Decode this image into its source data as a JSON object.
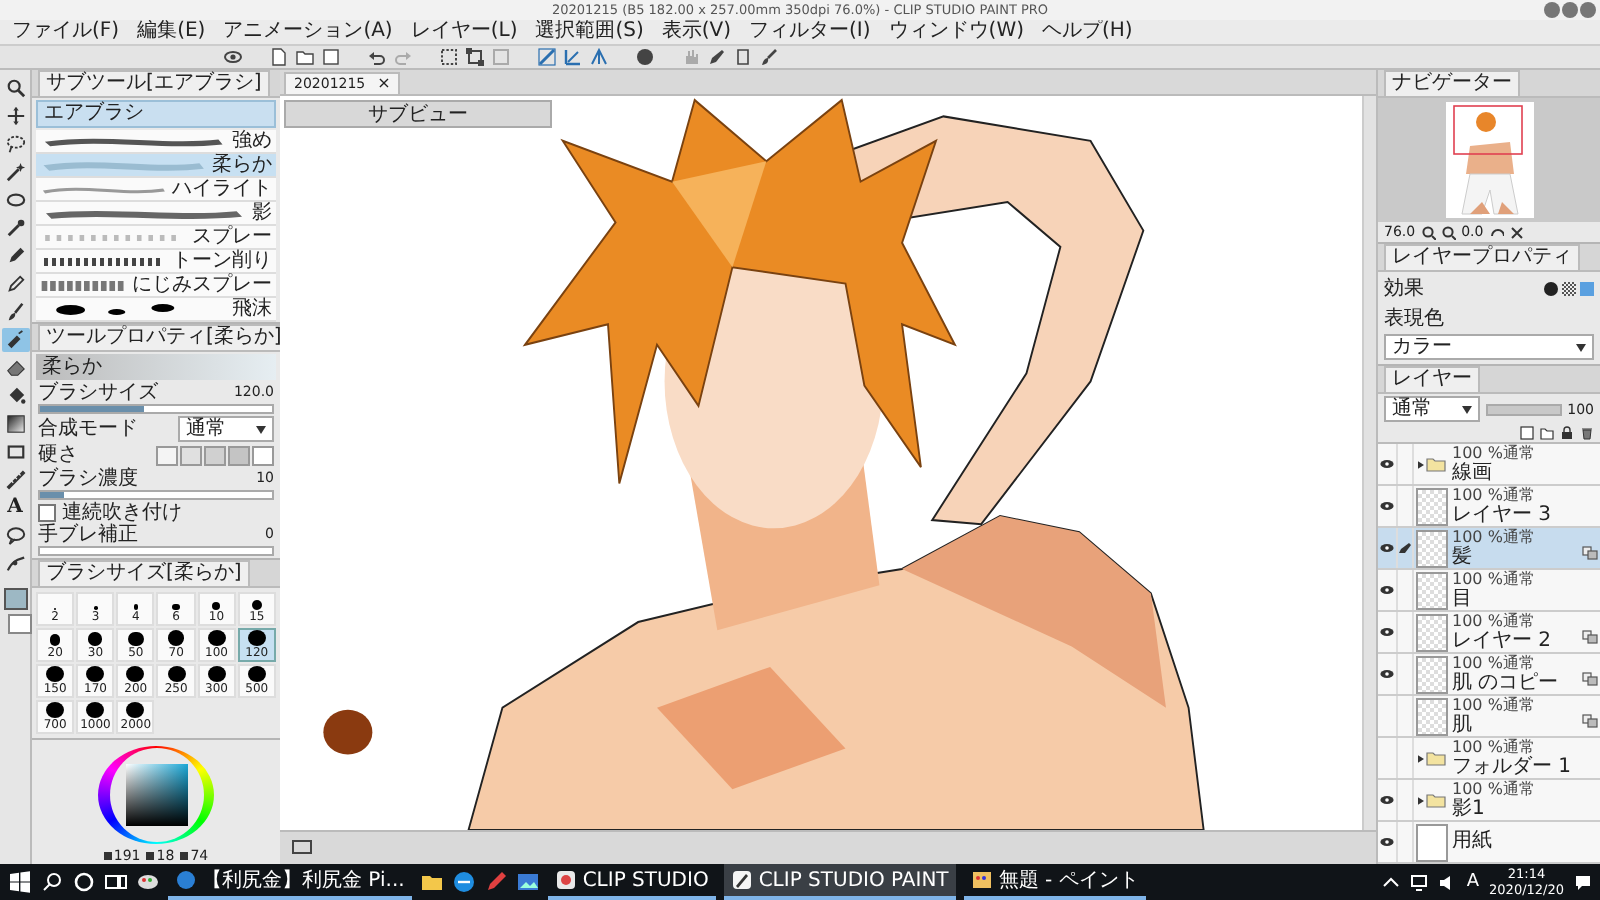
{
  "window": {
    "title": "20201215 (B5 182.00 x 257.00mm 350dpi 76.0%) - CLIP STUDIO PAINT PRO"
  },
  "menu": [
    "ファイル(F)",
    "編集(E)",
    "アニメーション(A)",
    "レイヤー(L)",
    "選択範囲(S)",
    "表示(V)",
    "フィルター(I)",
    "ウィンドウ(W)",
    "ヘルプ(H)"
  ],
  "tools": [
    {
      "kind": "zoom",
      "selected": false
    },
    {
      "kind": "move",
      "selected": false
    },
    {
      "kind": "lasso",
      "selected": false
    },
    {
      "kind": "wand",
      "selected": false
    },
    {
      "kind": "ellipse",
      "selected": false
    },
    {
      "kind": "dropper",
      "selected": false
    },
    {
      "kind": "pen",
      "selected": false
    },
    {
      "kind": "pencil",
      "selected": false
    },
    {
      "kind": "brush",
      "selected": false
    },
    {
      "kind": "airbrush",
      "selected": true
    },
    {
      "kind": "eraser",
      "selected": false
    },
    {
      "kind": "fill",
      "selected": false
    },
    {
      "kind": "gradient",
      "selected": false
    },
    {
      "kind": "figure",
      "selected": false
    },
    {
      "kind": "ruler",
      "selected": false
    },
    {
      "kind": "text",
      "glyph": "A",
      "selected": false
    },
    {
      "kind": "balloon",
      "selected": false
    },
    {
      "kind": "correct",
      "selected": false
    }
  ],
  "subtool_panel": {
    "tab": "サブツール[エアブラシ]",
    "group": "エアブラシ",
    "items": [
      {
        "label": "強め",
        "selected": false
      },
      {
        "label": "柔らか",
        "selected": true
      },
      {
        "label": "ハイライト",
        "selected": false
      },
      {
        "label": "影",
        "selected": false
      },
      {
        "label": "スプレー",
        "selected": false
      },
      {
        "label": "トーン削り",
        "selected": false
      },
      {
        "label": "にじみスプレー",
        "selected": false
      },
      {
        "label": "飛沫",
        "selected": false
      }
    ]
  },
  "tool_property": {
    "tab": "ツールプロパティ[柔らか]",
    "preset": "柔らか",
    "rows": [
      {
        "kind": "slider",
        "label": "ブラシサイズ",
        "value": "120.0",
        "level": 0.45
      },
      {
        "kind": "select",
        "label": "合成モード",
        "value": "通常"
      },
      {
        "kind": "swatches",
        "label": "硬さ"
      },
      {
        "kind": "slider",
        "label": "ブラシ濃度",
        "value": "10",
        "level": 0.1
      },
      {
        "kind": "checkbox",
        "label": "連続吹き付け",
        "checked": false
      },
      {
        "kind": "slider",
        "label": "手ブレ補正",
        "value": "0",
        "level": 0
      }
    ]
  },
  "brush_size_panel": {
    "tab": "ブラシサイズ[柔らか]",
    "sizes": [
      {
        "label": "2",
        "selected": false
      },
      {
        "label": "3",
        "selected": false
      },
      {
        "label": "4",
        "selected": false
      },
      {
        "label": "6",
        "selected": false
      },
      {
        "label": "10",
        "selected": false
      },
      {
        "label": "15",
        "selected": false
      },
      {
        "label": "20",
        "selected": false
      },
      {
        "label": "30",
        "selected": false
      },
      {
        "label": "50",
        "selected": false
      },
      {
        "label": "70",
        "selected": false
      },
      {
        "label": "100",
        "selected": false
      },
      {
        "label": "120",
        "selected": true
      },
      {
        "label": "150",
        "selected": false
      },
      {
        "label": "170",
        "selected": false
      },
      {
        "label": "200",
        "selected": false
      },
      {
        "label": "250",
        "selected": false
      },
      {
        "label": "300",
        "selected": false
      },
      {
        "label": "500",
        "selected": false
      },
      {
        "label": "700",
        "selected": false
      },
      {
        "label": "1000",
        "selected": false
      },
      {
        "label": "2000",
        "selected": false
      }
    ]
  },
  "color_panel": {
    "values": [
      "191",
      "18",
      "74"
    ]
  },
  "document_tab": {
    "title": "20201215",
    "close": "×"
  },
  "sub_view": {
    "title": "サブビュー"
  },
  "navigator": {
    "tab": "ナビゲーター",
    "zoom": "76.0",
    "rotation": "0.0"
  },
  "layer_property": {
    "tab": "レイヤープロパティ",
    "effect_label": "効果",
    "color_label": "表現色",
    "color_value": "カラー"
  },
  "layer_panel": {
    "tab": "レイヤー",
    "blend_mode": "通常",
    "opacity_slider": {
      "level": 1
    },
    "opacity": "100",
    "layers": [
      {
        "kind": "folder",
        "mode": "100 %通常",
        "name": "線画",
        "visible": true,
        "selected": false,
        "clipped": false
      },
      {
        "kind": "raster",
        "mode": "100 %通常",
        "name": "レイヤー 3",
        "visible": true,
        "selected": false,
        "clipped": false
      },
      {
        "kind": "raster",
        "mode": "100 %通常",
        "name": "髪",
        "visible": true,
        "selected": true,
        "clipped": true
      },
      {
        "kind": "raster",
        "mode": "100 %通常",
        "name": "目",
        "visible": true,
        "selected": false,
        "clipped": false
      },
      {
        "kind": "raster",
        "mode": "100 %通常",
        "name": "レイヤー 2",
        "visible": true,
        "selected": false,
        "clipped": true
      },
      {
        "kind": "raster",
        "mode": "100 %通常",
        "name": "肌 のコピー",
        "visible": true,
        "selected": false,
        "clipped": true
      },
      {
        "kind": "raster",
        "mode": "100 %通常",
        "name": "肌",
        "visible": false,
        "selected": false,
        "clipped": true
      },
      {
        "kind": "folder",
        "mode": "100 %通常",
        "name": "フォルダー 1",
        "visible": false,
        "selected": false,
        "clipped": false
      },
      {
        "kind": "folder",
        "mode": "100 %通常",
        "name": "影1",
        "visible": true,
        "selected": false,
        "clipped": false
      },
      {
        "kind": "paper",
        "name": "用紙",
        "visible": true,
        "selected": false,
        "clipped": false
      }
    ]
  },
  "taskbar": {
    "apps": [
      {
        "kind": "browser",
        "label": "【利尻金】利尻金 Pi...",
        "active": false
      },
      {
        "kind": "clip-studio",
        "label": "CLIP STUDIO",
        "active": false
      },
      {
        "kind": "clip-studio-paint",
        "label": "CLIP STUDIO PAINT",
        "active": true
      },
      {
        "kind": "paint",
        "label": "無題 - ペイント",
        "active": false
      }
    ],
    "ime": "A",
    "time": "21:14",
    "date": "2020/12/20"
  }
}
